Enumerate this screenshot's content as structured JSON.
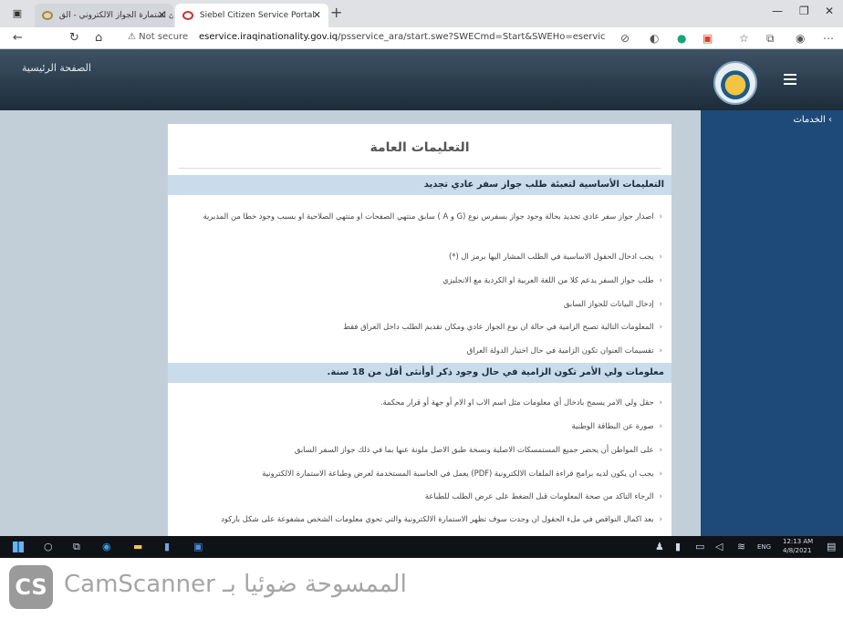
{
  "browser": {
    "tabs": [
      {
        "label": "ملئ استمارة الجواز الالكتروني - الق...",
        "active": false
      },
      {
        "label": "Siebel Citizen Service Portal",
        "active": true
      }
    ],
    "new_tab": "+",
    "security_label": "Not secure",
    "url_host": "eservice.iraqinationality.gov.iq",
    "url_path": "/psservice_ara/start.swe?SWECmd=Start&SWEHo=eservice.ir"
  },
  "site": {
    "home_link": "الصفحة الرئيسية",
    "sidebar_item": "› الخدمات"
  },
  "card": {
    "title": "التعليمات العامة",
    "section1": {
      "heading": "التعليمات الأساسية لتعبئة طلب جواز سفر عادي تجديد",
      "items": [
        "اصدار جواز سفر عادي تجديد بحالة وجود جواز بسفرس نوع (G و A ) سابق منتهي الصفحات او منتهي الصلاحية او بسبب وجود خطا من المديرية",
        "يجب ادخال الحقول الاساسية في الطلب المشار اليها برمز ال (*)",
        "طلب جواز السفر يدعم كلا من اللغة العربية او الكردية مع الانجليزي",
        "إدخال البيانات للجواز السابق",
        "المعلومات التالية تصبح الزامية في حالة ان نوع الجواز عادي ومكان تقديم الطلب داخل العراق فقط",
        "تقسيمات العنوان تكون الزامية في حال اختيار الدولة العراق"
      ]
    },
    "section2": {
      "heading": "معلومات ولي الأمر تكون الزامية في حال وجود ذكر أوأنثى أقل من 18 سنة.",
      "items": [
        "حقل ولي الامر يسمح بادخال أي معلومات مثل اسم الاب او الام أو جهة أو قرار محكمة.",
        "صورة عن البطاقة الوطنية",
        "على المواطن أن يحضر جميع المستمسكات الاصلية ونسخة طبق الاصل ملونة عنها بما في ذلك جواز السفر السابق",
        "يجب ان يكون لديه برامج قراءة الملفات الالكترونية (PDF) يعمل في الحاسبة المستخدمة لعرض وطباعة الاستمارة الالكترونية",
        "الرجاء التاكد من صحة المعلومات قبل الضغط على عرض الطلب للطباعة",
        "بعد اكمال النواقص في ملء الحقول ان وجدت سوف تظهر الاستمارة الالكترونية والتي تحوي معلومات الشخص مشفوعة على شكل باركود"
      ]
    }
  },
  "taskbar": {
    "clock_time": "12:13 AM",
    "clock_date": "4/8/2021",
    "lang": "ENG"
  },
  "watermark": {
    "logo": "CS",
    "text": "CamScanner الممسوحة ضوئيا بـ"
  }
}
